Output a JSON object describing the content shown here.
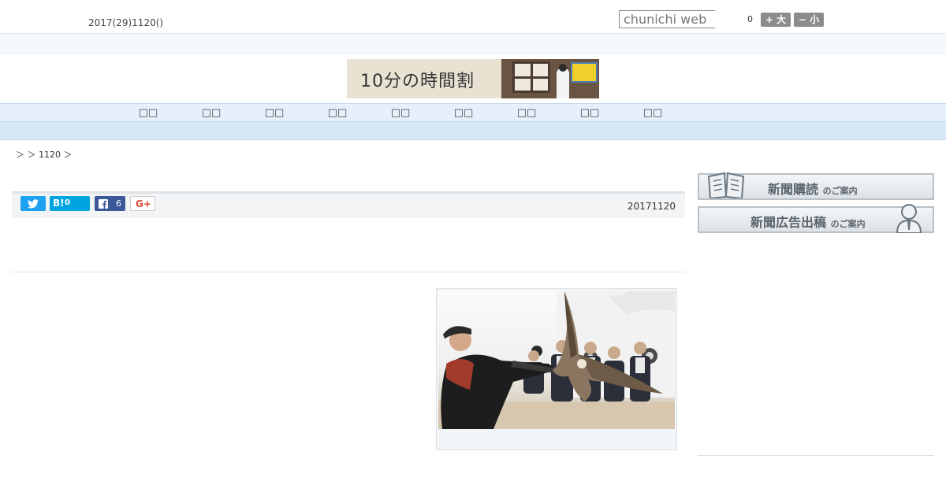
{
  "header": {
    "date": "2017(29)1120()",
    "search_placeholder": "chunichi web",
    "font_size_count": "0",
    "font_larger_label": "+ 大",
    "font_smaller_label": "− 小"
  },
  "banner": {
    "text": "10分の時間割"
  },
  "nav": {
    "items": [
      {
        "label": "□□"
      },
      {
        "label": "□□"
      },
      {
        "label": "□□"
      },
      {
        "label": "□□"
      },
      {
        "label": "□□"
      },
      {
        "label": "□□"
      },
      {
        "label": "□□"
      },
      {
        "label": "□□"
      },
      {
        "label": "□□"
      }
    ]
  },
  "breadcrumb": {
    "text": "＞ ＞ 1120 ＞"
  },
  "article": {
    "date": "20171120",
    "share": {
      "twitter_icon": "twitter-icon",
      "hatena_label": "B!",
      "hatena_count": "0",
      "facebook_icon": "facebook-icon",
      "facebook_count": "6",
      "gplus_label": "G+"
    },
    "photo_description": "falconer-photo"
  },
  "sidebar": {
    "subscribe_main": "新聞購読",
    "subscribe_sub": "のご案内",
    "advertise_main": "新聞広告出稿",
    "advertise_sub": "のご案内"
  },
  "colors": {
    "nav_bg": "#e6f0fb",
    "nav2_bg": "#d7e7f7",
    "twitter": "#1da1f2",
    "hatena": "#00a4de",
    "facebook": "#3b5998",
    "gplus": "#dd4b39"
  }
}
